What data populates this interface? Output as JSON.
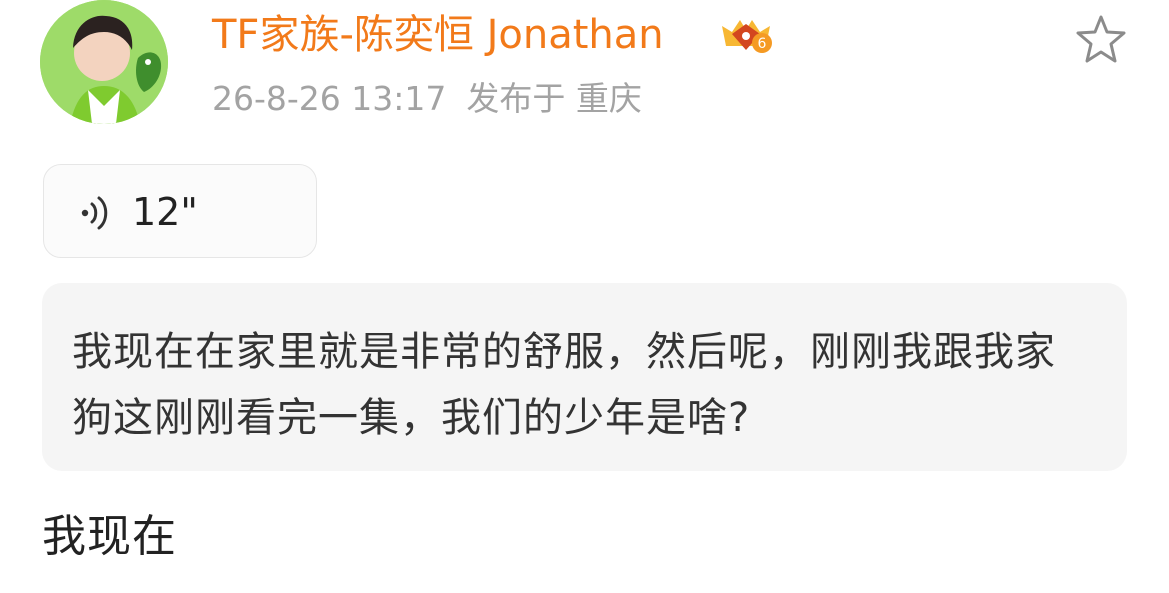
{
  "post": {
    "author": {
      "name": "TF家族-陈奕恒 Jonathan",
      "badge_icon": "vip-crown-icon",
      "badge_level": "6",
      "avatar_icon": "profile-avatar",
      "name_color": "#f27a1a"
    },
    "meta": {
      "time": "26-8-26 13:17",
      "location": "发布于 重庆"
    },
    "actions": {
      "favorite_icon": "star-outline-icon"
    },
    "voice": {
      "icon": "sound-wave-icon",
      "duration": "12\""
    },
    "transcript": "我现在在家里就是非常的舒服，然后呢，刚刚我跟我家狗这刚刚看完一集，我们的少年是啥?",
    "body_text": "我现在"
  }
}
